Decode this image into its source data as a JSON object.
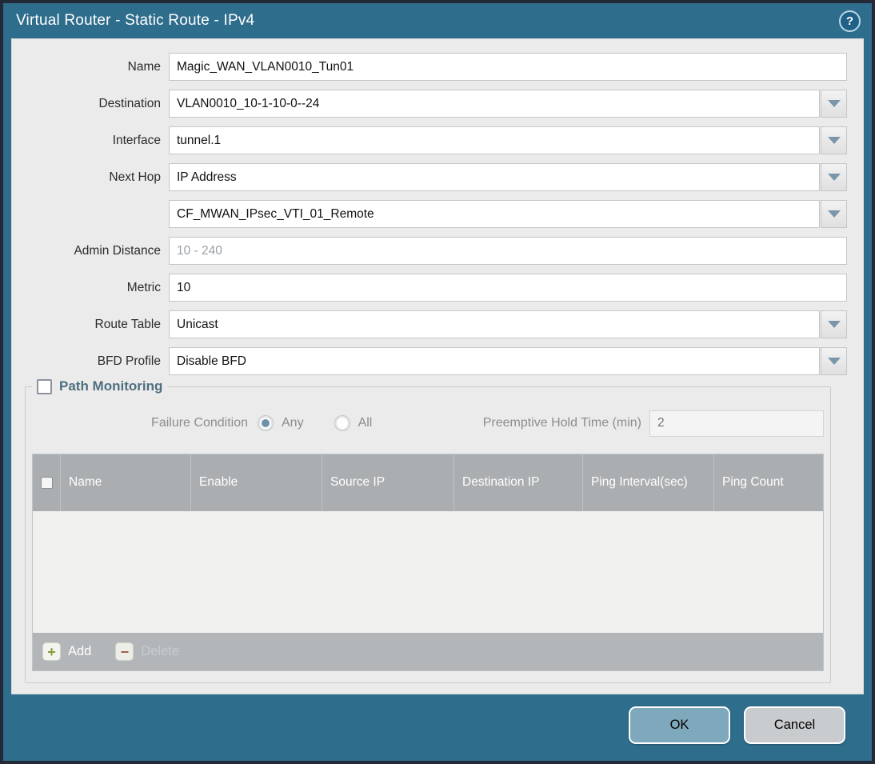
{
  "titlebar": {
    "title": "Virtual Router - Static Route - IPv4",
    "help": "?"
  },
  "form": {
    "fields": [
      {
        "label": "Name",
        "value": "Magic_WAN_VLAN0010_Tun01"
      },
      {
        "label": "Destination",
        "value": "VLAN0010_10-1-10-0--24"
      },
      {
        "label": "Interface",
        "value": "tunnel.1"
      },
      {
        "label": "Next Hop",
        "value": "IP Address"
      },
      {
        "label": "",
        "value": "CF_MWAN_IPsec_VTI_01_Remote"
      },
      {
        "label": "Admin Distance",
        "placeholder": "10 - 240"
      },
      {
        "label": "Metric",
        "value": "10"
      },
      {
        "label": "Route Table",
        "value": "Unicast"
      },
      {
        "label": "BFD Profile",
        "value": "Disable BFD"
      }
    ]
  },
  "path_monitoring": {
    "legend": "Path Monitoring",
    "checked": false,
    "failure_condition": {
      "label": "Failure Condition",
      "options": [
        "Any",
        "All"
      ],
      "selected": "Any"
    },
    "preemptive_hold": {
      "label": "Preemptive Hold Time (min)",
      "value": "2"
    },
    "table": {
      "headers": [
        "Name",
        "Enable",
        "Source IP",
        "Destination IP",
        "Ping Interval(sec)",
        "Ping Count"
      ],
      "rows": []
    },
    "toolbar": {
      "add": "Add",
      "delete": "Delete"
    }
  },
  "footer": {
    "ok": "OK",
    "cancel": "Cancel"
  },
  "colors": {
    "titlebar_teal": "#2e6d8c",
    "content_bg": "#ebebeb",
    "header_bg": "#aaaeb1",
    "toolbar_bg": "#b2b6b9",
    "ok_button": "#7ea9bd",
    "cancel_button": "#c9ccce",
    "dropdown_arrow": "#7b96aa",
    "radio_fill": "#6d93a8",
    "add_icon_green": "#7f9c3a",
    "delete_icon_red": "#a05a50",
    "legend_text": "#4e6e80"
  }
}
